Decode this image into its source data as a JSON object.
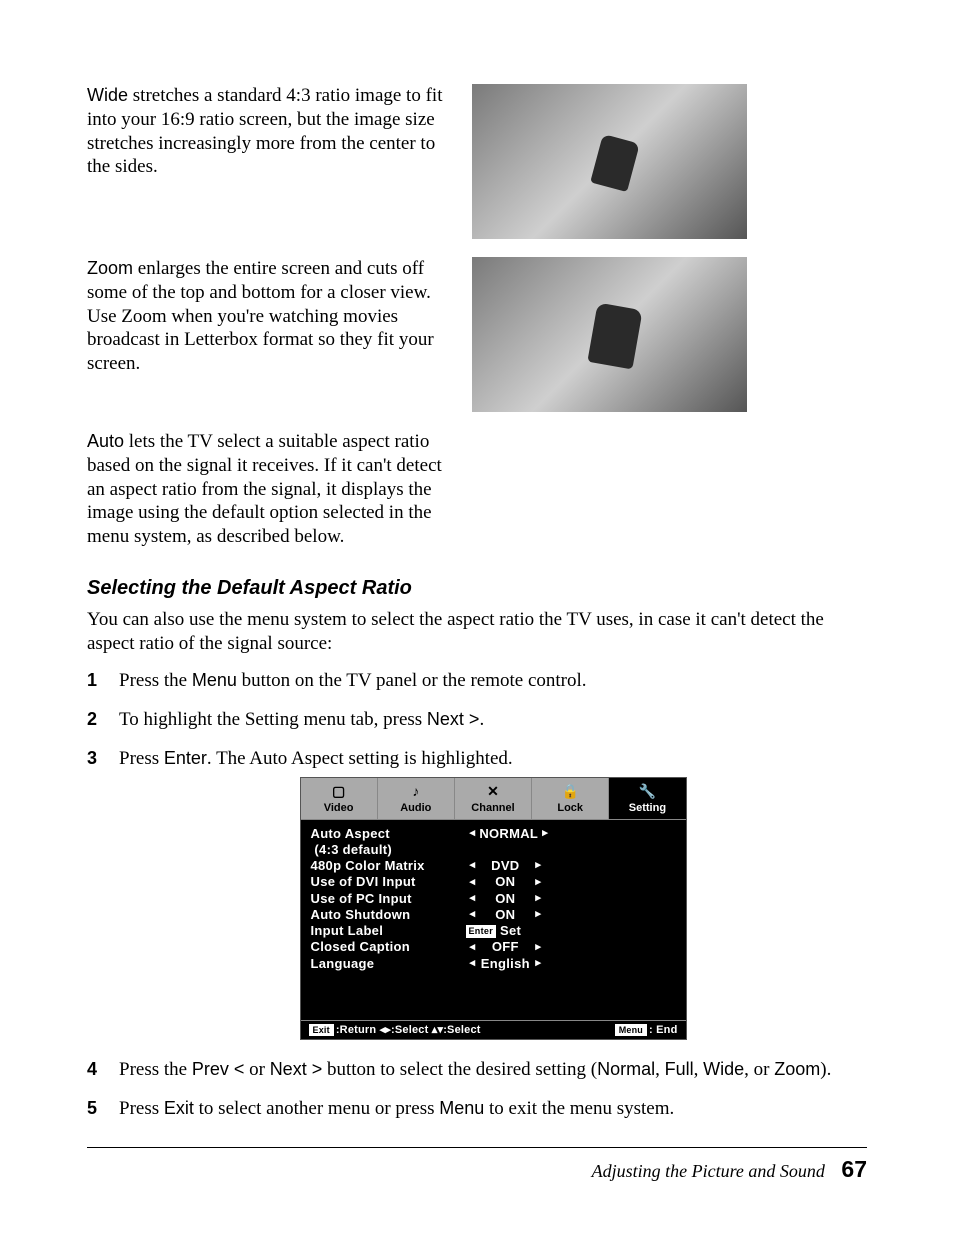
{
  "paragraphs": {
    "wide_term": "Wide",
    "wide_body": " stretches a standard 4:3 ratio image to fit into your 16:9 ratio screen, but the image size stretches increasingly more from the center to the sides.",
    "zoom_term": "Zoom",
    "zoom_body": " enlarges the entire screen and cuts off some of the top and bottom for a closer view. Use Zoom when you're watching movies broadcast in Letterbox format so they fit your screen.",
    "auto_term": "Auto",
    "auto_body": " lets the TV select a suitable aspect ratio based on the signal it receives. If it can't detect an aspect ratio from the signal, it displays the image using the default option selected in the menu system, as described below."
  },
  "heading": "Selecting the Default Aspect Ratio",
  "intro": "You can also use the menu system to select the aspect ratio the TV uses, in case it can't detect the aspect ratio of the signal source:",
  "steps": {
    "s1_a": "Press the ",
    "s1_term": "Menu",
    "s1_b": " button on the TV panel or the remote control.",
    "s2_a": "To highlight the Setting menu tab, press ",
    "s2_term": "Next >",
    "s2_b": ".",
    "s3_a": "Press ",
    "s3_term": "Enter",
    "s3_b": ". The Auto Aspect setting is highlighted.",
    "s4_a": "Press the ",
    "s4_t1": "Prev <",
    "s4_b": " or ",
    "s4_t2": "Next >",
    "s4_c": " button to select the desired setting (",
    "s4_t3": "Normal",
    "s4_d": ", ",
    "s4_t4": "Full",
    "s4_e": ", ",
    "s4_t5": "Wide",
    "s4_f": ", or ",
    "s4_t6": "Zoom",
    "s4_g": ").",
    "s5_a": "Press ",
    "s5_t1": "Exit",
    "s5_b": " to select another menu or press ",
    "s5_t2": "Menu",
    "s5_c": " to exit the menu system."
  },
  "osd": {
    "tabs": [
      "Video",
      "Audio",
      "Channel",
      "Lock",
      "Setting"
    ],
    "icons": [
      "▢",
      "♪",
      "✕",
      "🔒",
      "🔧"
    ],
    "rows": [
      {
        "label": "Auto Aspect",
        "value": "NORMAL",
        "arrows": true
      },
      {
        "label": " (4:3 default)",
        "value": "",
        "arrows": false
      },
      {
        "label": "480p Color Matrix",
        "value": "DVD",
        "arrows": true
      },
      {
        "label": "Use of DVI Input",
        "value": "ON",
        "arrows": true
      },
      {
        "label": "Use of PC Input",
        "value": "ON",
        "arrows": true
      },
      {
        "label": "Auto Shutdown",
        "value": "ON",
        "arrows": true
      },
      {
        "label": "Input Label",
        "value": "Set",
        "enter": true
      },
      {
        "label": "Closed Caption",
        "value": "OFF",
        "arrows": true
      },
      {
        "label": "Language",
        "value": "English",
        "arrows": true
      }
    ],
    "foot_left_btn": "Exit",
    "foot_left": ":Return  ◂▸:Select  ▴▾:Select",
    "foot_right_btn": "Menu",
    "foot_right": ": End"
  },
  "footer": {
    "title": "Adjusting the Picture and Sound",
    "page": "67"
  }
}
